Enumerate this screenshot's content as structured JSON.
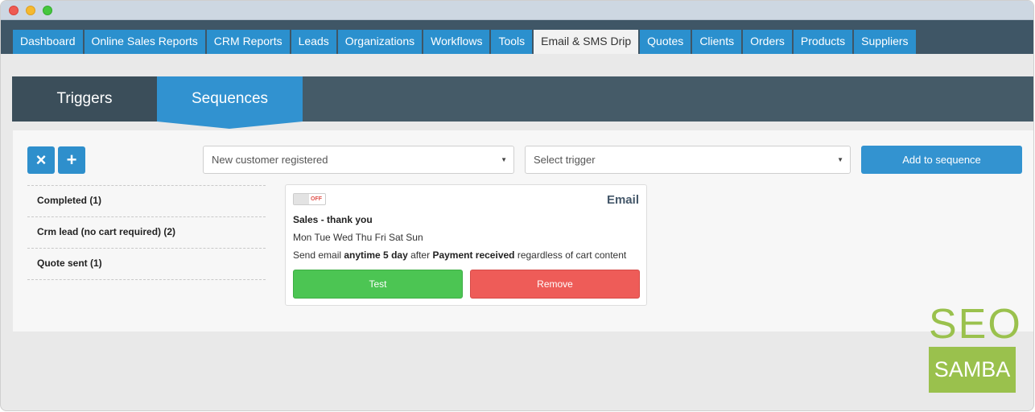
{
  "nav": {
    "tabs": [
      {
        "label": "Dashboard"
      },
      {
        "label": "Online Sales Reports"
      },
      {
        "label": "CRM Reports"
      },
      {
        "label": "Leads"
      },
      {
        "label": "Organizations"
      },
      {
        "label": "Workflows"
      },
      {
        "label": "Tools"
      },
      {
        "label": "Email & SMS Drip",
        "active": true
      },
      {
        "label": "Quotes"
      },
      {
        "label": "Clients"
      },
      {
        "label": "Orders"
      },
      {
        "label": "Products"
      },
      {
        "label": "Suppliers"
      }
    ]
  },
  "section_tabs": {
    "triggers": "Triggers",
    "sequences": "Sequences",
    "active": "Sequences"
  },
  "toolbar": {
    "delete_icon": "×",
    "add_icon": "+",
    "sequence_select": {
      "value": "New customer registered"
    },
    "trigger_select": {
      "value": "Select trigger"
    },
    "add_to_sequence_label": "Add to sequence"
  },
  "sequences": [
    {
      "label": "Completed (1)"
    },
    {
      "label": "Crm lead (no cart required) (2)"
    },
    {
      "label": "Quote sent (1)"
    }
  ],
  "card": {
    "toggle_state": "OFF",
    "type": "Email",
    "title": "Sales - thank you",
    "days": "Mon Tue Wed Thu Fri Sat Sun",
    "desc": {
      "p1": "Send email ",
      "b1": "anytime 5 day",
      "p2": " after ",
      "b2": "Payment received",
      "p3": " regardless of cart content"
    },
    "test_label": "Test",
    "remove_label": "Remove"
  },
  "logo": {
    "top": "SEO",
    "bottom": "SAMBA"
  },
  "colors": {
    "nav_bg": "#3f5666",
    "tab_blue": "#2b90ce",
    "section_bg": "#455b68",
    "accent": "#3192d0",
    "success": "#4cc553",
    "danger": "#ee5c58",
    "logo_green": "#9ac14d"
  }
}
